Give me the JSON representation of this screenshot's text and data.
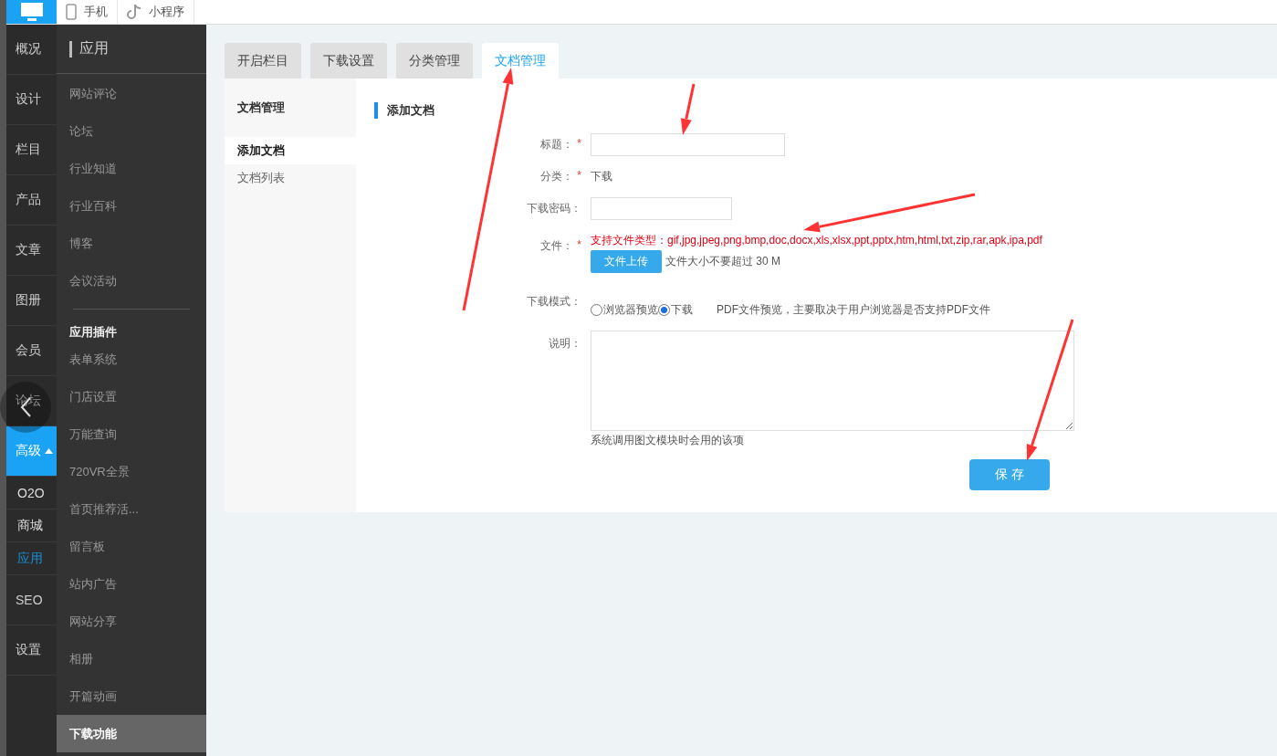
{
  "top_bar": {
    "tabs": [
      {
        "label": "手机",
        "kind": "phone"
      },
      {
        "label": "小程序",
        "kind": "miniprogram"
      }
    ]
  },
  "nav": {
    "items": [
      {
        "label": "概况",
        "selected": false
      },
      {
        "label": "设计",
        "selected": false
      },
      {
        "label": "栏目",
        "selected": false
      },
      {
        "label": "产品",
        "selected": false
      },
      {
        "label": "文章",
        "selected": false
      },
      {
        "label": "图册",
        "selected": false
      },
      {
        "label": "会员",
        "selected": false
      },
      {
        "label": "论坛",
        "selected": false
      },
      {
        "label": "高级",
        "selected": true,
        "expanded": true,
        "children": [
          {
            "label": "O2O",
            "selected": false
          },
          {
            "label": "商城",
            "selected": false
          },
          {
            "label": "应用",
            "selected": true
          }
        ]
      },
      {
        "label": "SEO",
        "selected": false
      },
      {
        "label": "设置",
        "selected": false
      }
    ]
  },
  "submenu": {
    "title": "应用",
    "groups": [
      {
        "items": [
          {
            "label": "网站评论",
            "selected": false
          },
          {
            "label": "论坛",
            "selected": false
          },
          {
            "label": "行业知道",
            "selected": false
          },
          {
            "label": "行业百科",
            "selected": false
          },
          {
            "label": "博客",
            "selected": false
          },
          {
            "label": "会议活动",
            "selected": false
          }
        ]
      },
      {
        "heading": "应用插件",
        "items": [
          {
            "label": "表单系统",
            "selected": false
          },
          {
            "label": "门店设置",
            "selected": false
          },
          {
            "label": "万能查询",
            "selected": false
          },
          {
            "label": "720VR全景",
            "selected": false
          },
          {
            "label": "首页推荐活...",
            "selected": false
          },
          {
            "label": "留言板",
            "selected": false
          },
          {
            "label": "站内广告",
            "selected": false
          },
          {
            "label": "网站分享",
            "selected": false
          },
          {
            "label": "相册",
            "selected": false
          },
          {
            "label": "开篇动画",
            "selected": false
          },
          {
            "label": "下载功能",
            "selected": true
          }
        ]
      }
    ]
  },
  "tabs": [
    {
      "label": "开启栏目",
      "selected": false
    },
    {
      "label": "下载设置",
      "selected": false
    },
    {
      "label": "分类管理",
      "selected": false
    },
    {
      "label": "文档管理",
      "selected": true
    }
  ],
  "doc_menu": {
    "title": "文档管理",
    "items": [
      {
        "label": "添加文档",
        "selected": true
      },
      {
        "label": "文档列表",
        "selected": false
      }
    ]
  },
  "form": {
    "title": "添加文档",
    "fields": [
      {
        "kind": "text",
        "label": "标题：",
        "required": true
      },
      {
        "kind": "static",
        "label": "分类：",
        "required": true,
        "value": "下载"
      },
      {
        "kind": "password",
        "label": "下载密码：",
        "required": false
      },
      {
        "kind": "file",
        "label": "文件：",
        "required": true,
        "types": "支持文件类型：gif,jpg,jpeg,png,bmp,doc,docx,xls,xlsx,ppt,pptx,htm,html,txt,zip,rar,apk,ipa,pdf",
        "button": "文件上传",
        "note": "文件大小不要超过 30 M"
      },
      {
        "kind": "radio",
        "label": "下载模式：",
        "required": false,
        "options": [
          {
            "label": "浏览器预览",
            "selected": false
          },
          {
            "label": "下载",
            "selected": true
          }
        ],
        "note": "PDF文件预览，主要取决于用户浏览器是否支持PDF文件"
      },
      {
        "kind": "textarea",
        "label": "说明：",
        "required": false,
        "help": "系统调用图文模块时会用的该项"
      }
    ],
    "required_mark": "*",
    "save_button": "保 存"
  }
}
